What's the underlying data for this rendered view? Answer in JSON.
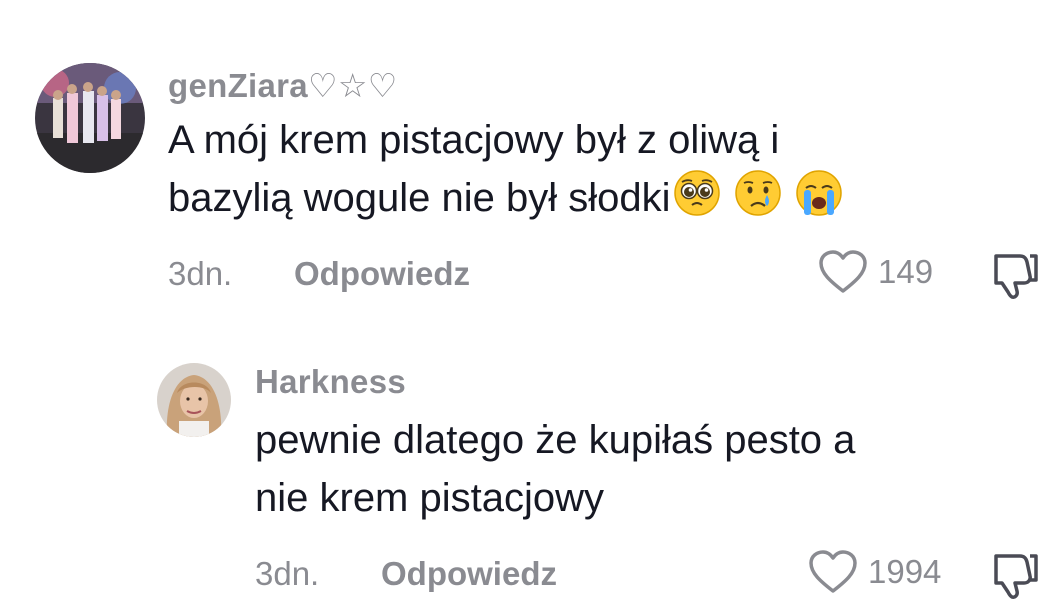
{
  "comments": [
    {
      "username": "genZiara♡☆♡",
      "text_line1": "A mój krem pistacjowy był z oliwą i",
      "text_line2": "bazylią wogule nie był słodki",
      "emojis": [
        "pleading-face",
        "crying-face",
        "loudly-crying-face"
      ],
      "time": "3dn.",
      "reply_label": "Odpowiedz",
      "likes": "149"
    },
    {
      "username": "Harkness",
      "text_line1": "pewnie dlatego że kupiłaś pesto a",
      "text_line2": "nie krem pistacjowy",
      "time": "3dn.",
      "reply_label": "Odpowiedz",
      "likes": "1994"
    }
  ],
  "icons": {
    "like": "heart-outline-icon",
    "dislike": "thumbs-down-outline-icon"
  },
  "colors": {
    "text_primary": "#161823",
    "text_secondary": "#8a8b91",
    "emoji_yellow": "#ffcc33"
  }
}
